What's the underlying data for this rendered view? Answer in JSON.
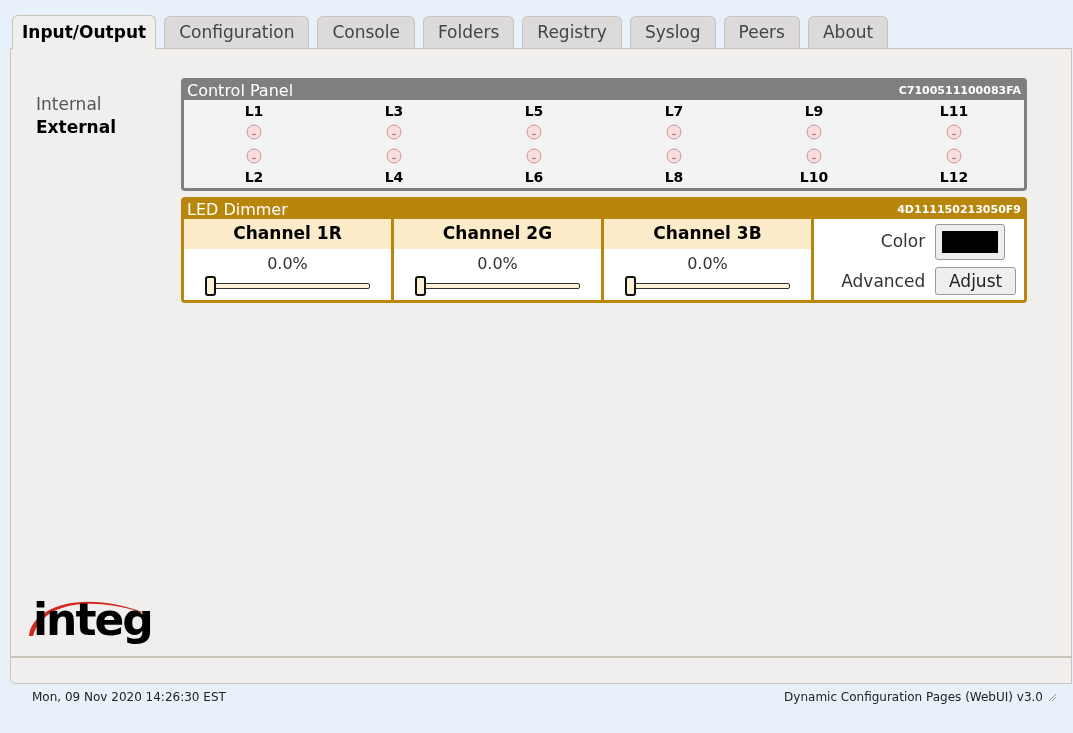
{
  "tabs": [
    {
      "label": "Input/Output",
      "selected": true
    },
    {
      "label": "Configuration",
      "selected": false
    },
    {
      "label": "Console",
      "selected": false
    },
    {
      "label": "Folders",
      "selected": false
    },
    {
      "label": "Registry",
      "selected": false
    },
    {
      "label": "Syslog",
      "selected": false
    },
    {
      "label": "Peers",
      "selected": false
    },
    {
      "label": "About",
      "selected": false
    }
  ],
  "sidebar": {
    "items": [
      {
        "label": "Internal",
        "selected": false
      },
      {
        "label": "External",
        "selected": true
      }
    ]
  },
  "control_panel": {
    "title": "Control Panel",
    "serial": "C7100511100083FA",
    "columns": [
      {
        "top": {
          "label": "L1",
          "lit": false
        },
        "bottom": {
          "label": "L2",
          "lit": false
        }
      },
      {
        "top": {
          "label": "L3",
          "lit": false
        },
        "bottom": {
          "label": "L4",
          "lit": false
        }
      },
      {
        "top": {
          "label": "L5",
          "lit": false
        },
        "bottom": {
          "label": "L6",
          "lit": false
        }
      },
      {
        "top": {
          "label": "L7",
          "lit": false
        },
        "bottom": {
          "label": "L8",
          "lit": false
        }
      },
      {
        "top": {
          "label": "L9",
          "lit": false
        },
        "bottom": {
          "label": "L10",
          "lit": false
        }
      },
      {
        "top": {
          "label": "L11",
          "lit": false
        },
        "bottom": {
          "label": "L12",
          "lit": false
        }
      }
    ]
  },
  "led_dimmer": {
    "title": "LED Dimmer",
    "serial": "4D111150213050F9",
    "channels": [
      {
        "name": "Channel 1R",
        "reading": "0.0%",
        "level": 0
      },
      {
        "name": "Channel 2G",
        "reading": "0.0%",
        "level": 0
      },
      {
        "name": "Channel 3B",
        "reading": "0.0%",
        "level": 0
      }
    ],
    "color": {
      "label": "Color",
      "color": "#000000"
    },
    "advanced": {
      "label": "Advanced",
      "button": "Adjust"
    }
  },
  "logo": "integ",
  "status_bar": {
    "datetime": "Mon, 09 Nov 2020 14:26:30 EST",
    "product": "Dynamic Configuration Pages (WebUI) v3.0"
  }
}
